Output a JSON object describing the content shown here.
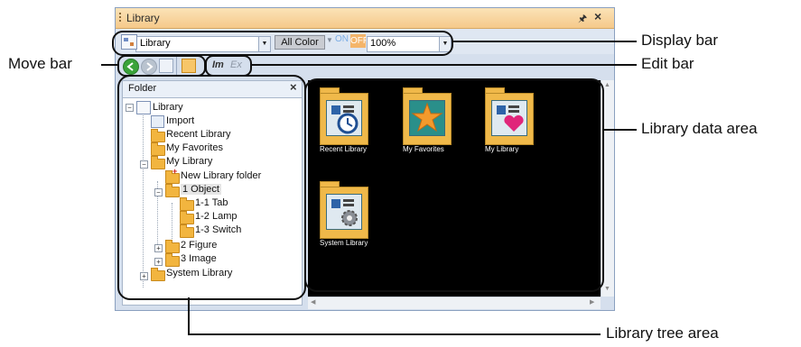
{
  "window": {
    "title": "Library",
    "pin": "⌖",
    "close": "×"
  },
  "display_bar": {
    "library_select": "Library",
    "color_button": "All Color",
    "on_label": "ON",
    "off_label": "OFF",
    "zoom": "100%"
  },
  "edit_bar": {
    "insert_label": "Im",
    "export_label": "Ex"
  },
  "folder_panel": {
    "title": "Folder",
    "close": "×",
    "tree": [
      {
        "label": "Library"
      },
      {
        "label": "Import"
      },
      {
        "label": "Recent Library"
      },
      {
        "label": "My Favorites"
      },
      {
        "label": "My Library"
      },
      {
        "label": "New Library folder"
      },
      {
        "label": "1 Object"
      },
      {
        "label": "1-1 Tab"
      },
      {
        "label": "1-2 Lamp"
      },
      {
        "label": "1-3 Switch"
      },
      {
        "label": "2 Figure"
      },
      {
        "label": "3 Image"
      },
      {
        "label": "System Library"
      }
    ]
  },
  "data_area": {
    "items": [
      {
        "label": "Recent Library",
        "icon": "clock-icon"
      },
      {
        "label": "My Favorites",
        "icon": "star-icon"
      },
      {
        "label": "My Library",
        "icon": "heart-icon"
      },
      {
        "label": "System Library",
        "icon": "gear-icon"
      }
    ]
  },
  "callouts": {
    "display_bar": "Display bar",
    "edit_bar": "Edit bar",
    "move_bar": "Move bar",
    "library_data_area": "Library data area",
    "library_tree_area": "Library tree area"
  },
  "colors": {
    "titlebar": "#f5c98a",
    "data_area_bg": "#000000",
    "folder": "#f2b53f",
    "off_button": "#f4b56a"
  }
}
